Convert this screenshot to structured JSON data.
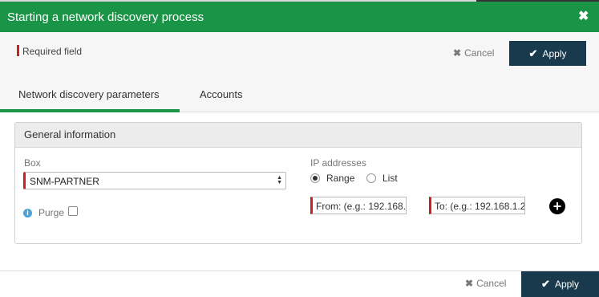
{
  "dialog": {
    "title": "Starting a network discovery process",
    "close_icon": "close-icon"
  },
  "header": {
    "required_field": "Required field",
    "cancel_label": "Cancel",
    "apply_label": "Apply"
  },
  "tabs": [
    {
      "label": "Network discovery parameters",
      "active": true
    },
    {
      "label": "Accounts",
      "active": false
    }
  ],
  "general_info": {
    "title": "General information",
    "box_label": "Box",
    "box_value": "SNM-PARTNER",
    "purge_label": "Purge",
    "purge_checked": false
  },
  "ip_addresses": {
    "label": "IP addresses",
    "mode_range": "Range",
    "mode_list": "List",
    "selected_mode": "Range",
    "from_placeholder": "From: (e.g.: 192.168.",
    "to_placeholder": "To: (e.g.: 192.168.1.2"
  },
  "footer": {
    "cancel_label": "Cancel",
    "apply_label": "Apply"
  },
  "colors": {
    "title_bar": "#1a9446",
    "apply_button": "#193a4d",
    "required_marker": "#cc1f1f",
    "active_tab": "#1a9446"
  }
}
